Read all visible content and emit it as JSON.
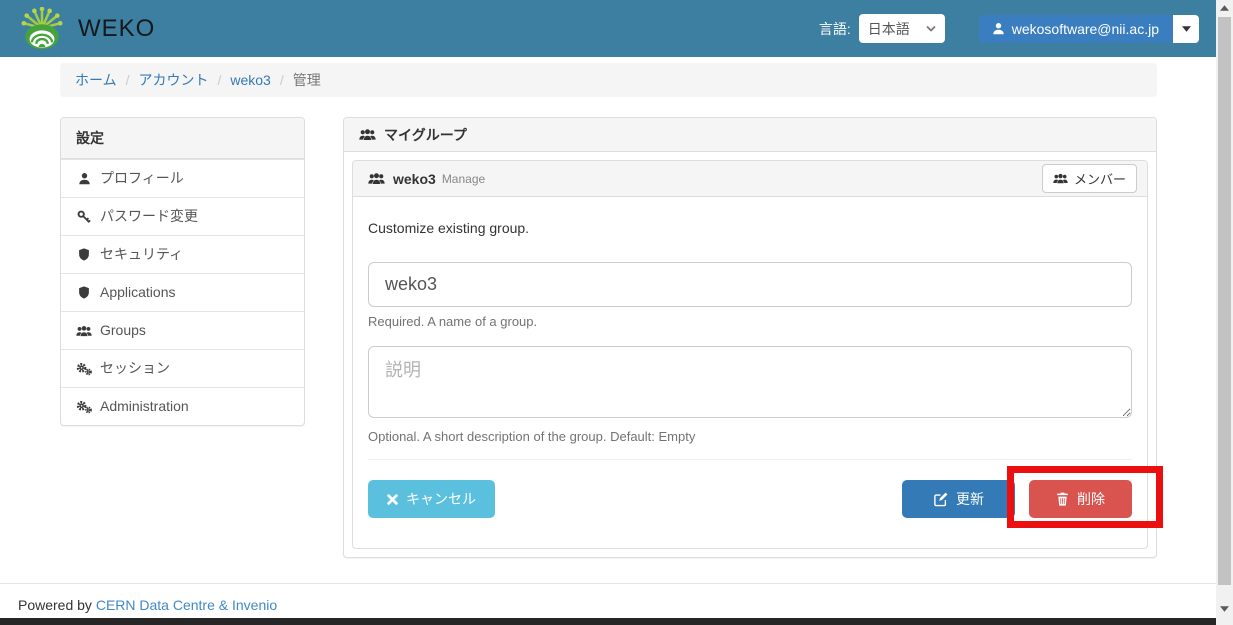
{
  "navbar": {
    "brand": "WEKO",
    "language_label": "言語:",
    "language_value": "日本語",
    "user_email": "wekosoftware@nii.ac.jp"
  },
  "breadcrumb": {
    "separator": "/",
    "items": [
      "ホーム",
      "アカウント",
      "weko3"
    ],
    "active": "管理"
  },
  "sidebar": {
    "header": "設定",
    "items": [
      {
        "icon": "user-icon",
        "label": "プロフィール"
      },
      {
        "icon": "key-icon",
        "label": "パスワード変更"
      },
      {
        "icon": "shield-icon",
        "label": "セキュリティ"
      },
      {
        "icon": "shield-icon",
        "label": "Applications"
      },
      {
        "icon": "users-icon",
        "label": "Groups"
      },
      {
        "icon": "cogs-icon",
        "label": "セッション"
      },
      {
        "icon": "cogs-icon",
        "label": "Administration"
      }
    ]
  },
  "main": {
    "panel_title": "マイグループ",
    "group_header": {
      "name": "weko3",
      "mode": "Manage",
      "members_button": "メンバー"
    },
    "form": {
      "intro": "Customize existing group.",
      "name_value": "weko3",
      "name_help": "Required. A name of a group.",
      "desc_placeholder": "説明",
      "desc_help": "Optional. A short description of the group. Default: Empty",
      "cancel_label": "キャンセル",
      "update_label": "更新",
      "delete_label": "削除"
    }
  },
  "footer": {
    "powered_by": "Powered by",
    "credit_link": "CERN Data Centre & Invenio"
  },
  "colors": {
    "navbar": "#3d7fa1",
    "primary": "#337ab7",
    "info": "#5bc0de",
    "danger": "#d9534f",
    "highlight_box": "#ec0f0f"
  }
}
